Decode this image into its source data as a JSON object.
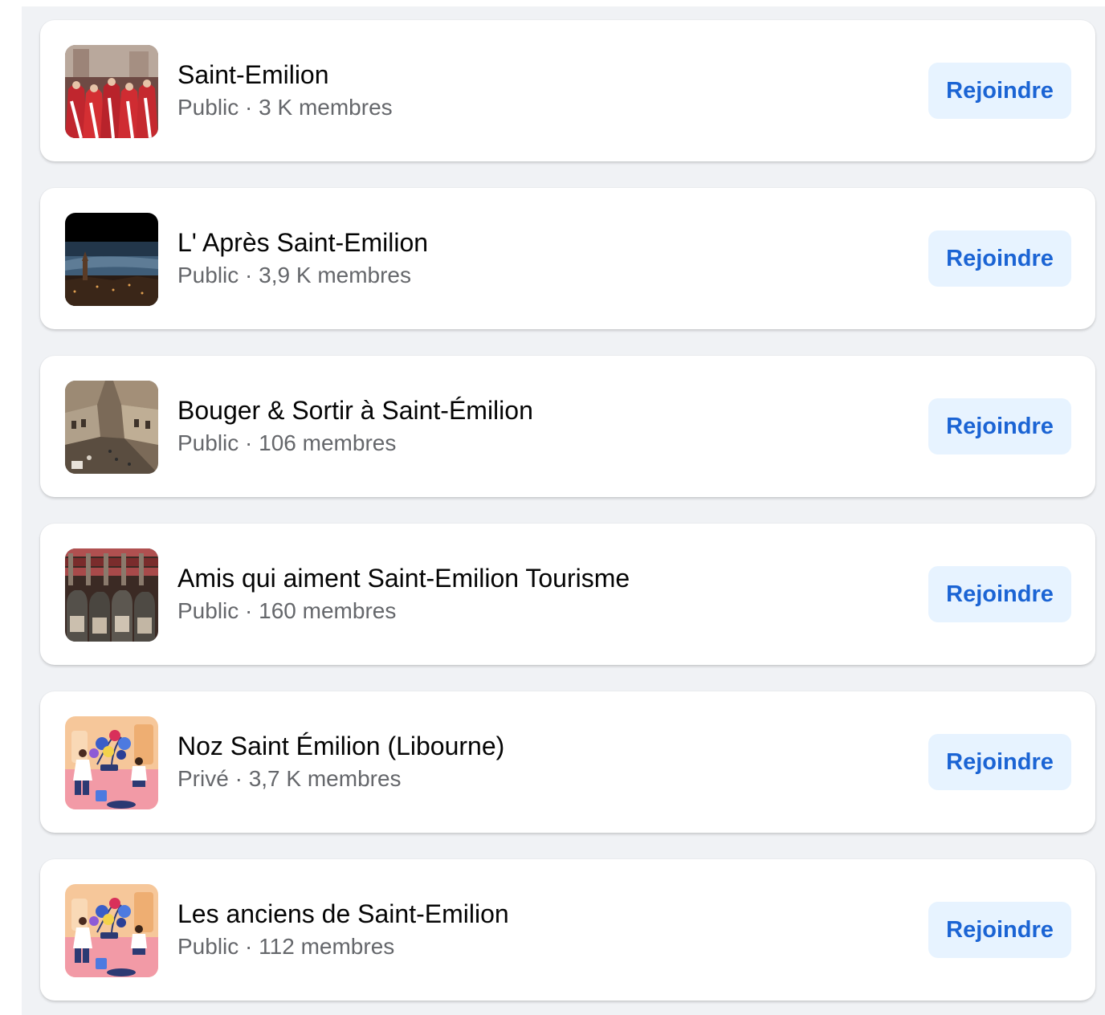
{
  "groups": [
    {
      "name": "Saint-Emilion",
      "privacy": "Public",
      "members": "3 K membres",
      "button_label": "Rejoindre",
      "thumbnail": "red-robed-procession-photo"
    },
    {
      "name": "L' Après Saint-Emilion",
      "privacy": "Public",
      "members": "3,9 K membres",
      "button_label": "Rejoindre",
      "thumbnail": "town-skyline-dusk-photo"
    },
    {
      "name": "Bouger & Sortir à Saint-Émilion",
      "privacy": "Public",
      "members": "106 membres",
      "button_label": "Rejoindre",
      "thumbnail": "old-town-square-photo"
    },
    {
      "name": "Amis qui aiment Saint-Emilion Tourisme",
      "privacy": "Public",
      "members": "160 membres",
      "button_label": "Rejoindre",
      "thumbnail": "wine-bottles-photo"
    },
    {
      "name": "Noz Saint Émilion (Libourne)",
      "privacy": "Privé",
      "members": "3,7 K membres",
      "button_label": "Rejoindre",
      "thumbnail": "default-group-illustration"
    },
    {
      "name": "Les anciens de Saint-Emilion",
      "privacy": "Public",
      "members": "112 membres",
      "button_label": "Rejoindre",
      "thumbnail": "default-group-illustration"
    }
  ],
  "meta_separator": " · ",
  "colors": {
    "background": "#f0f2f5",
    "card": "#ffffff",
    "title_text": "#050505",
    "meta_text": "#65676b",
    "button_bg": "#e7f3ff",
    "button_text": "#1b64d4"
  }
}
